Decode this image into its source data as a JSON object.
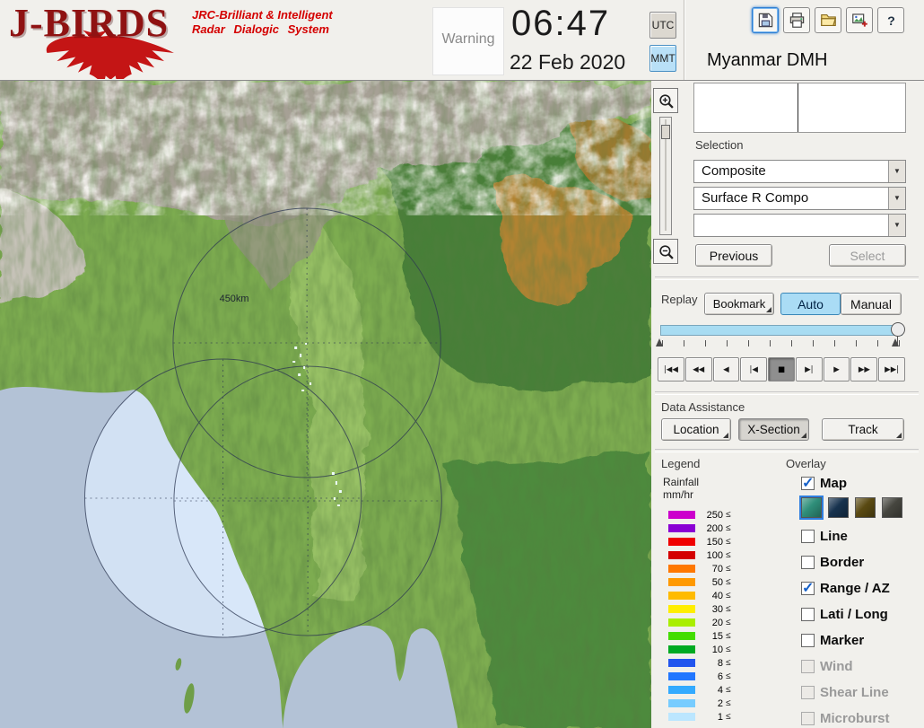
{
  "header": {
    "logo": {
      "title": "J-BIRDS",
      "subtitle_line1": "JRC-Brilliant & Intelligent",
      "subtitle_line2": "Radar Dialogic System"
    },
    "warning_label": "Warning",
    "clock": {
      "time": "06:47",
      "date": "22 Feb 2020"
    },
    "timezones": [
      {
        "label": "UTC",
        "active": false
      },
      {
        "label": "MMT",
        "active": true
      }
    ],
    "toolbar_icons": [
      "save",
      "print",
      "open-folder",
      "add-image",
      "help"
    ],
    "save_button_focused": true,
    "station_name": "Myanmar DMH"
  },
  "map": {
    "range_ring_label": "450km",
    "range_rings": 3
  },
  "selection": {
    "label": "Selection",
    "dropdowns": [
      {
        "value": "Composite"
      },
      {
        "value": "Surface R Compo"
      },
      {
        "value": ""
      }
    ],
    "previous_button": "Previous",
    "select_button": "Select",
    "select_disabled": true
  },
  "replay": {
    "label": "Replay",
    "bookmark_button": "Bookmark",
    "auto_button": "Auto",
    "manual_button": "Manual",
    "auto_active": true,
    "slider_position_percent": 97,
    "playback_buttons": [
      {
        "symbol": "|◀◀",
        "pressed": false
      },
      {
        "symbol": "◀◀",
        "pressed": false
      },
      {
        "symbol": "◀",
        "pressed": false
      },
      {
        "symbol": "|◀",
        "pressed": false
      },
      {
        "symbol": "■",
        "pressed": true
      },
      {
        "symbol": "▶|",
        "pressed": false
      },
      {
        "symbol": "▶",
        "pressed": false
      },
      {
        "symbol": "▶▶",
        "pressed": false
      },
      {
        "symbol": "▶▶|",
        "pressed": false
      }
    ]
  },
  "data_assistance": {
    "label": "Data Assistance",
    "buttons": [
      {
        "label": "Location",
        "pressed": false
      },
      {
        "label": "X-Section",
        "pressed": true
      },
      {
        "label": "Track",
        "pressed": false
      }
    ]
  },
  "legend": {
    "label": "Legend",
    "unit_line1": "Rainfall",
    "unit_line2": "mm/hr",
    "lte_symbol": "≤",
    "entries": [
      {
        "value": "250",
        "color": "#cc00cc"
      },
      {
        "value": "200",
        "color": "#8a00d4"
      },
      {
        "value": "150",
        "color": "#f00000"
      },
      {
        "value": "100",
        "color": "#d40000"
      },
      {
        "value": "70",
        "color": "#ff7800"
      },
      {
        "value": "50",
        "color": "#ff9900"
      },
      {
        "value": "40",
        "color": "#ffbb00"
      },
      {
        "value": "30",
        "color": "#ffee00"
      },
      {
        "value": "20",
        "color": "#aaee00"
      },
      {
        "value": "15",
        "color": "#44dd00"
      },
      {
        "value": "10",
        "color": "#00aa22"
      },
      {
        "value": "8",
        "color": "#2255ee"
      },
      {
        "value": "6",
        "color": "#2277ff"
      },
      {
        "value": "4",
        "color": "#33aaff"
      },
      {
        "value": "2",
        "color": "#77ccff"
      },
      {
        "value": "1",
        "color": "#bbe6ff"
      }
    ]
  },
  "overlay": {
    "label": "Overlay",
    "items": [
      {
        "label": "Map",
        "checked": true,
        "disabled": false
      },
      {
        "label": "Line",
        "checked": false,
        "disabled": false
      },
      {
        "label": "Border",
        "checked": false,
        "disabled": false
      },
      {
        "label": "Range / AZ",
        "checked": true,
        "disabled": false
      },
      {
        "label": "Lati / Long",
        "checked": false,
        "disabled": false
      },
      {
        "label": "Marker",
        "checked": false,
        "disabled": false
      },
      {
        "label": "Wind",
        "checked": false,
        "disabled": true
      },
      {
        "label": "Shear Line",
        "checked": false,
        "disabled": true
      },
      {
        "label": "Microburst",
        "checked": false,
        "disabled": true
      }
    ],
    "map_style_swatches": [
      "#2f8f7a",
      "#17324e",
      "#5a4a12",
      "#46463f"
    ],
    "style_selected": [
      true,
      false,
      false,
      false
    ]
  }
}
